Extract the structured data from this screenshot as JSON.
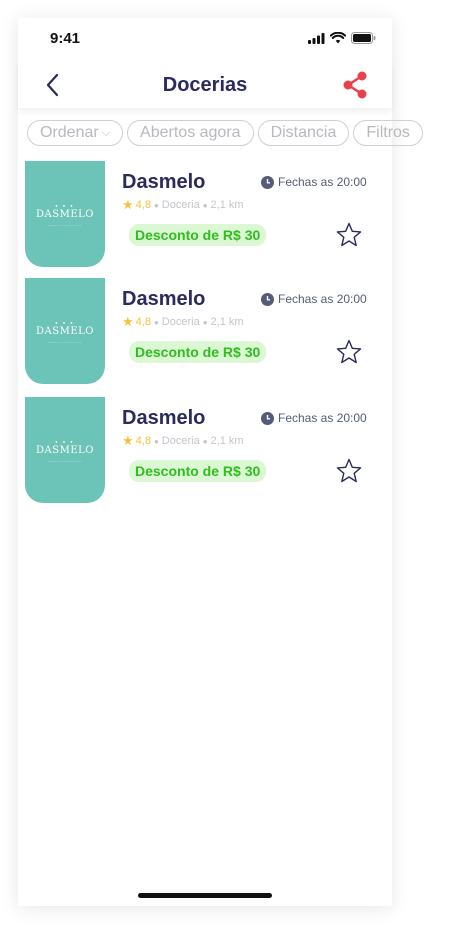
{
  "status": {
    "time": "9:41"
  },
  "header": {
    "title": "Docerias"
  },
  "filters": [
    {
      "label": "Ordenar",
      "has_dropdown": true
    },
    {
      "label": "Abertos agora"
    },
    {
      "label": "Distancia"
    },
    {
      "label": "Filtros"
    }
  ],
  "stores": [
    {
      "name": "Dasmelo",
      "logo_text": "DASMELO",
      "rating": "4,8",
      "category": "Doceria",
      "distance": "2,1 km",
      "hours": "Fechas as 20:00",
      "discount": "Desconto de R$ 30"
    },
    {
      "name": "Dasmelo",
      "logo_text": "DASMELO",
      "rating": "4,8",
      "category": "Doceria",
      "distance": "2,1 km",
      "hours": "Fechas as 20:00",
      "discount": "Desconto de R$ 30"
    },
    {
      "name": "Dasmelo",
      "logo_text": "DASMELO",
      "rating": "4,8",
      "category": "Doceria",
      "distance": "2,1 km",
      "hours": "Fechas as 20:00",
      "discount": "Desconto de R$ 30"
    }
  ],
  "colors": {
    "title": "#2b2a5e",
    "accent_share": "#e8414b",
    "thumb": "#6cc3b7",
    "discount_text": "#2fbe1e",
    "discount_bg": "#dbf7d4",
    "rating": "#f6c23a"
  },
  "icons": {
    "back": "chevron-left-icon",
    "share": "share-icon",
    "favorite": "star-outline-icon",
    "clock": "clock-icon",
    "rating": "star-filled-icon"
  }
}
